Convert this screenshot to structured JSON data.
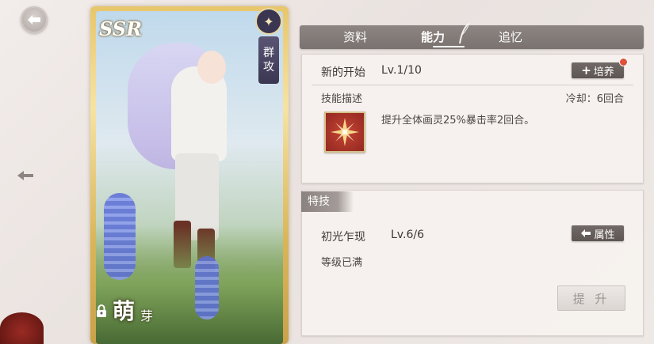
{
  "card": {
    "rarity": "SSR",
    "attack_type": [
      "群",
      "攻"
    ],
    "name_main": "萌",
    "name_sub": "芽"
  },
  "tabs": [
    {
      "label": "资料",
      "active": false
    },
    {
      "label": "能力",
      "active": true
    },
    {
      "label": "追忆",
      "active": false
    }
  ],
  "skill": {
    "name": "新的开始",
    "level": "Lv.1/10",
    "train_label": "培养",
    "description_label": "技能描述",
    "cooldown": "冷却：6回合",
    "description": "提升全体画灵25%暴击率2回合。",
    "icon": "sparkle-burst-icon"
  },
  "special": {
    "tag": "特技",
    "name": "初光乍现",
    "level": "Lv.6/6",
    "attribute_label": "属性",
    "status": "等级已满",
    "upgrade_label": "提 升",
    "upgrade_enabled": false
  },
  "colors": {
    "tab_bar": "#7f7774",
    "button": "#625a57",
    "notification_dot": "#e0503a",
    "skill_icon_bg": "#a8322a"
  }
}
